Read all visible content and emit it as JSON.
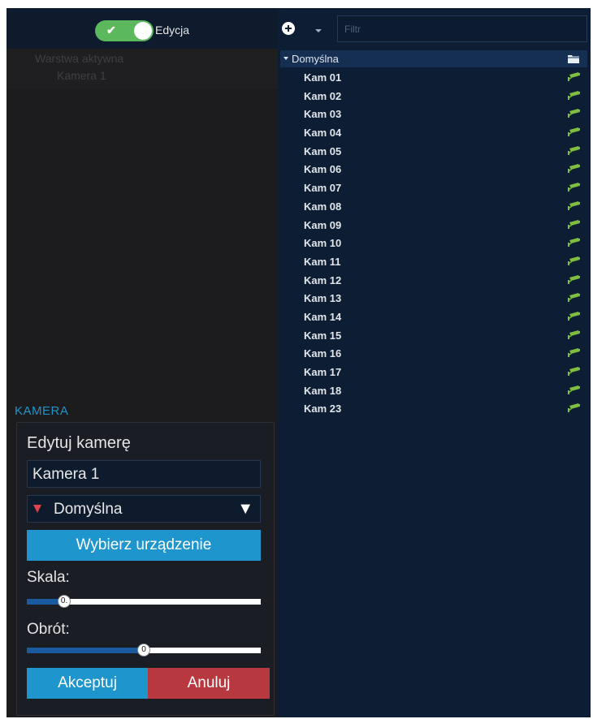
{
  "toolbar": {
    "edit_toggle_label": "Edycja",
    "edit_toggle_on": true
  },
  "layers": {
    "items": [
      "Warstwa aktywna",
      "Kamera 1"
    ]
  },
  "camera_section": {
    "title": "KAMERA",
    "edit_heading": "Edytuj kamerę",
    "name_value": "Kamera 1",
    "group_select": "Domyślna",
    "choose_device": "Wybierz urządzenie",
    "scale_label": "Skala:",
    "scale_value_text": "0.",
    "scale_level": 0.16,
    "rotation_label": "Obrót:",
    "rotation_value_text": "0",
    "rotation_level": 0.5,
    "accept": "Akceptuj",
    "cancel": "Anuluj"
  },
  "tree": {
    "filter_placeholder": "Filtr",
    "group_name": "Domyślna",
    "cameras": [
      "Kam 01",
      "Kam 02",
      "Kam 03",
      "Kam 04",
      "Kam 05",
      "Kam 06",
      "Kam 07",
      "Kam 08",
      "Kam 09",
      "Kam 10",
      "Kam 11",
      "Kam 12",
      "Kam 13",
      "Kam 14",
      "Kam 15",
      "Kam 16",
      "Kam 17",
      "Kam 18",
      "Kam 23"
    ]
  },
  "colors": {
    "accent": "#1e95cc",
    "cancel": "#b8383f",
    "camera_icon": "#7fbf3f",
    "toggle_on": "#5cb85c"
  }
}
